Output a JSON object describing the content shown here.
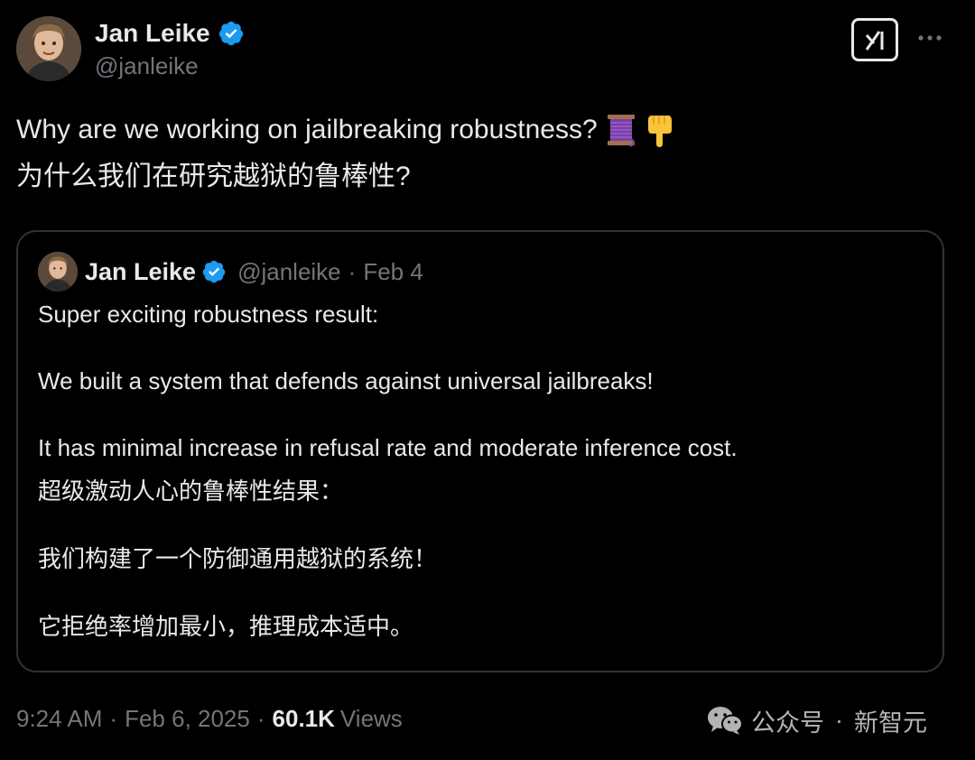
{
  "author": {
    "name": "Jan Leike",
    "handle": "@janleike"
  },
  "tweet": {
    "line1": "Why are we working on jailbreaking robustness?",
    "line2": "为什么我们在研究越狱的鲁棒性?",
    "emojis": [
      "thread-spool-icon",
      "pointing-down-icon"
    ]
  },
  "quoted": {
    "name": "Jan Leike",
    "handle": "@janleike",
    "separator": "·",
    "date": "Feb 4",
    "paragraphs": [
      "Super exciting robustness result:",
      "We built a system that defends against universal jailbreaks!",
      "It has minimal increase in refusal rate and moderate inference cost.",
      "超级激动人心的鲁棒性结果：",
      "我们构建了一个防御通用越狱的系统！",
      "它拒绝率增加最小，推理成本适中。"
    ]
  },
  "meta": {
    "time": "9:24 AM",
    "separator": "·",
    "date": "Feb 6, 2025",
    "views_count": "60.1K",
    "views_label": "Views"
  },
  "watermark": {
    "left": "公众号",
    "separator": "·",
    "right": "新智元"
  },
  "colors": {
    "background": "#000000",
    "text": "#e7e9ea",
    "muted": "#71767b",
    "verified": "#1d9bf0",
    "border": "#2f3336"
  }
}
